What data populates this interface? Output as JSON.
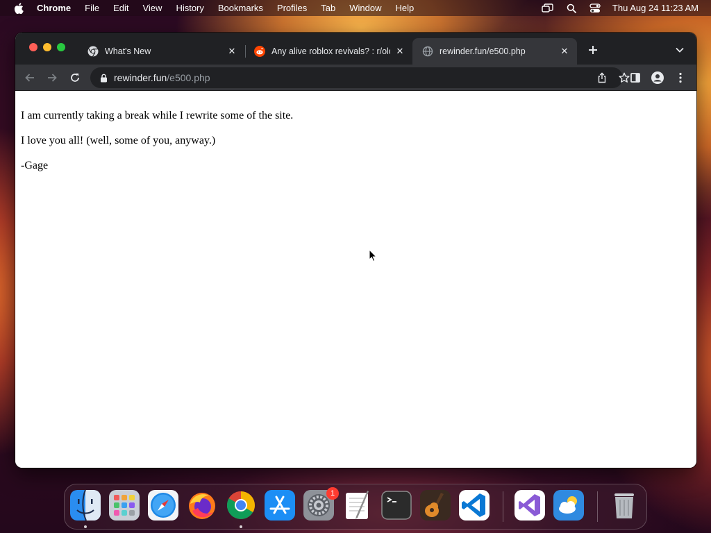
{
  "menubar": {
    "app_name": "Chrome",
    "items": [
      "File",
      "Edit",
      "View",
      "History",
      "Bookmarks",
      "Profiles",
      "Tab",
      "Window",
      "Help"
    ],
    "clock": "Thu Aug 24  11:23 AM"
  },
  "browser": {
    "tabs": [
      {
        "title": "What's New",
        "favicon": "chrome-icon",
        "active": false
      },
      {
        "title": "Any alive roblox revivals? : r/old",
        "favicon": "reddit-icon",
        "active": false
      },
      {
        "title": "rewinder.fun/e500.php",
        "favicon": "globe-icon",
        "active": true
      }
    ],
    "url_host": "rewinder.fun",
    "url_path": "/e500.php"
  },
  "page": {
    "paragraphs": [
      "I am currently taking a break while I rewrite some of the site.",
      "I love you all! (well, some of you, anyway.)",
      "-Gage"
    ]
  },
  "dock": {
    "apps": [
      "Finder",
      "Launchpad",
      "Safari",
      "Firefox",
      "Google Chrome",
      "App Store",
      "System Settings",
      "TextEdit",
      "Terminal",
      "GarageBand",
      "Visual Studio Code",
      "Visual Studio",
      "Weather",
      "Trash"
    ],
    "system_settings_badge": "1"
  },
  "colors": {
    "tabstrip": "#202124",
    "toolbar": "#35363a",
    "active_tab": "#35363a",
    "badge": "#ff3b30"
  }
}
